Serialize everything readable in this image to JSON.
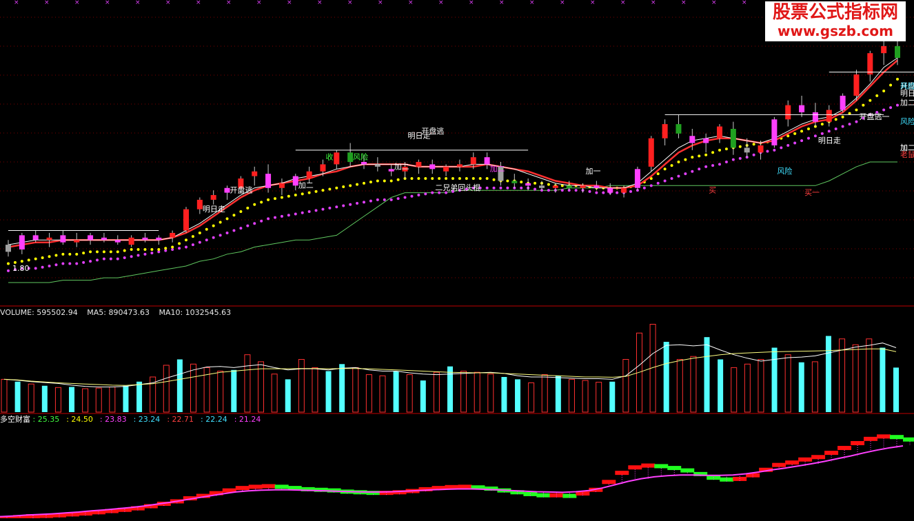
{
  "colors": {
    "up": "#ff2020",
    "down_cyan": "#54ffff",
    "vol_up": "#ff3030",
    "ma_white": "#ffffff",
    "ma_yellow": "#ffff00",
    "dots_yellow": "#ffff00",
    "dots_magenta": "#e040fb",
    "green_line": "#60c860",
    "grid": "#800000",
    "signal_white": "#ffffff",
    "signal_yellow": "#ffff00",
    "signal_cyan": "#40e0ff",
    "signal_green": "#40ff40",
    "signal_magenta": "#ff40ff"
  },
  "watermark": {
    "line1": "股票公式指标网",
    "line2": "www.gszb.com"
  },
  "volume_header": {
    "label": "VOLUME: 595502.94",
    "ma5": "MA5: 890473.63",
    "ma10": "MA10: 1032545.63"
  },
  "indicator_header": {
    "name": "多空财富",
    "values": [
      {
        "text": ": 25.35",
        "color": "#40ff40"
      },
      {
        "text": ": 24.50",
        "color": "#ffff00"
      },
      {
        "text": ": 23.83",
        "color": "#ff40ff"
      },
      {
        "text": ": 23.24",
        "color": "#40e0ff"
      },
      {
        "text": ": 22.71",
        "color": "#ff4040"
      },
      {
        "text": ": 22.24",
        "color": "#40e0ff"
      },
      {
        "text": ": 21.24",
        "color": "#ff40ff"
      }
    ]
  },
  "price_label": "1.80",
  "signals": [
    {
      "text": "明日走",
      "color": "#ffffff"
    },
    {
      "text": "开盘逃",
      "color": "#ffffff"
    },
    {
      "text": "加二",
      "color": "#ffffff"
    },
    {
      "text": "收",
      "color": "#40ff40"
    },
    {
      "text": "风险",
      "color": "#40ff40"
    },
    {
      "text": "明日走",
      "color": "#ffffff"
    },
    {
      "text": "开盘逃",
      "color": "#ffffff"
    },
    {
      "text": "加二",
      "color": "#ffffff"
    },
    {
      "text": "二兄弟回头棍",
      "color": "#ffffff"
    },
    {
      "text": "加一",
      "color": "#ffffff"
    },
    {
      "text": "加二",
      "color": "#ff40ff"
    },
    {
      "text": "风险",
      "color": "#40e0ff"
    },
    {
      "text": "买",
      "color": "#ff4040"
    },
    {
      "text": "买一",
      "color": "#ff4040"
    },
    {
      "text": "明日走",
      "color": "#ffffff"
    },
    {
      "text": "开盘逃一",
      "color": "#ffffff"
    },
    {
      "text": "风险",
      "color": "#40e0ff"
    },
    {
      "text": "加二",
      "color": "#ffffff"
    },
    {
      "text": "老鼠仓",
      "color": "#ff4040"
    },
    {
      "text": "加二",
      "color": "#ffffff"
    },
    {
      "text": "开盘逃",
      "color": "#ffffff"
    },
    {
      "text": "风险",
      "color": "#40e0ff"
    },
    {
      "text": "明日走",
      "color": "#ffffff"
    },
    {
      "text": "加二",
      "color": "#ffffff"
    }
  ],
  "chart_data": [
    {
      "type": "candlestick",
      "name": "price",
      "candles": [
        {
          "o": 1.74,
          "h": 1.76,
          "l": 1.69,
          "c": 1.71
        },
        {
          "o": 1.72,
          "h": 1.79,
          "l": 1.7,
          "c": 1.78
        },
        {
          "o": 1.78,
          "h": 1.8,
          "l": 1.75,
          "c": 1.76
        },
        {
          "o": 1.76,
          "h": 1.79,
          "l": 1.73,
          "c": 1.77
        },
        {
          "o": 1.78,
          "h": 1.8,
          "l": 1.74,
          "c": 1.75
        },
        {
          "o": 1.75,
          "h": 1.79,
          "l": 1.73,
          "c": 1.76
        },
        {
          "o": 1.76,
          "h": 1.79,
          "l": 1.74,
          "c": 1.78
        },
        {
          "o": 1.77,
          "h": 1.79,
          "l": 1.75,
          "c": 1.76
        },
        {
          "o": 1.76,
          "h": 1.78,
          "l": 1.74,
          "c": 1.75
        },
        {
          "o": 1.74,
          "h": 1.78,
          "l": 1.73,
          "c": 1.77
        },
        {
          "o": 1.77,
          "h": 1.79,
          "l": 1.75,
          "c": 1.76
        },
        {
          "o": 1.76,
          "h": 1.78,
          "l": 1.74,
          "c": 1.77
        },
        {
          "o": 1.77,
          "h": 1.8,
          "l": 1.75,
          "c": 1.79
        },
        {
          "o": 1.8,
          "h": 1.9,
          "l": 1.79,
          "c": 1.89
        },
        {
          "o": 1.89,
          "h": 1.94,
          "l": 1.87,
          "c": 1.93
        },
        {
          "o": 1.93,
          "h": 1.97,
          "l": 1.91,
          "c": 1.95
        },
        {
          "o": 1.96,
          "h": 1.99,
          "l": 1.93,
          "c": 1.98
        },
        {
          "o": 1.98,
          "h": 2.03,
          "l": 1.96,
          "c": 2.02
        },
        {
          "o": 2.03,
          "h": 2.07,
          "l": 1.99,
          "c": 2.05
        },
        {
          "o": 2.04,
          "h": 2.08,
          "l": 1.96,
          "c": 1.98
        },
        {
          "o": 1.98,
          "h": 2.02,
          "l": 1.95,
          "c": 2.0
        },
        {
          "o": 1.99,
          "h": 2.04,
          "l": 1.97,
          "c": 2.03
        },
        {
          "o": 2.02,
          "h": 2.07,
          "l": 2.0,
          "c": 2.05
        },
        {
          "o": 2.05,
          "h": 2.1,
          "l": 2.03,
          "c": 2.08
        },
        {
          "o": 2.08,
          "h": 2.14,
          "l": 2.06,
          "c": 2.13
        },
        {
          "o": 2.13,
          "h": 2.17,
          "l": 2.07,
          "c": 2.09
        },
        {
          "o": 2.09,
          "h": 2.12,
          "l": 2.06,
          "c": 2.08
        },
        {
          "o": 2.08,
          "h": 2.11,
          "l": 2.05,
          "c": 2.07
        },
        {
          "o": 2.06,
          "h": 2.08,
          "l": 2.03,
          "c": 2.05
        },
        {
          "o": 2.05,
          "h": 2.09,
          "l": 2.02,
          "c": 2.07
        },
        {
          "o": 2.07,
          "h": 2.1,
          "l": 2.04,
          "c": 2.09
        },
        {
          "o": 2.08,
          "h": 2.1,
          "l": 2.04,
          "c": 2.06
        },
        {
          "o": 2.05,
          "h": 2.08,
          "l": 2.03,
          "c": 2.07
        },
        {
          "o": 2.07,
          "h": 2.1,
          "l": 2.05,
          "c": 2.08
        },
        {
          "o": 2.08,
          "h": 2.13,
          "l": 2.06,
          "c": 2.11
        },
        {
          "o": 2.11,
          "h": 2.13,
          "l": 2.06,
          "c": 2.08
        },
        {
          "o": 2.07,
          "h": 2.09,
          "l": 1.99,
          "c": 2.01
        },
        {
          "o": 2.01,
          "h": 2.04,
          "l": 1.98,
          "c": 2.0
        },
        {
          "o": 2.0,
          "h": 2.02,
          "l": 1.97,
          "c": 1.99
        },
        {
          "o": 1.99,
          "h": 2.01,
          "l": 1.97,
          "c": 1.98
        },
        {
          "o": 1.98,
          "h": 2.0,
          "l": 1.96,
          "c": 1.99
        },
        {
          "o": 1.99,
          "h": 2.01,
          "l": 1.97,
          "c": 1.98
        },
        {
          "o": 1.98,
          "h": 2.0,
          "l": 1.96,
          "c": 1.99
        },
        {
          "o": 1.99,
          "h": 2.01,
          "l": 1.97,
          "c": 1.98
        },
        {
          "o": 1.98,
          "h": 2.0,
          "l": 1.95,
          "c": 1.96
        },
        {
          "o": 1.96,
          "h": 1.99,
          "l": 1.94,
          "c": 1.98
        },
        {
          "o": 1.98,
          "h": 2.07,
          "l": 1.97,
          "c": 2.06
        },
        {
          "o": 2.07,
          "h": 2.2,
          "l": 2.05,
          "c": 2.19
        },
        {
          "o": 2.19,
          "h": 2.27,
          "l": 2.16,
          "c": 2.25
        },
        {
          "o": 2.25,
          "h": 2.29,
          "l": 2.19,
          "c": 2.21
        },
        {
          "o": 2.2,
          "h": 2.23,
          "l": 2.14,
          "c": 2.17
        },
        {
          "o": 2.17,
          "h": 2.21,
          "l": 2.13,
          "c": 2.19
        },
        {
          "o": 2.19,
          "h": 2.25,
          "l": 2.17,
          "c": 2.24
        },
        {
          "o": 2.23,
          "h": 2.26,
          "l": 2.12,
          "c": 2.15
        },
        {
          "o": 2.15,
          "h": 2.19,
          "l": 2.11,
          "c": 2.13
        },
        {
          "o": 2.13,
          "h": 2.18,
          "l": 2.1,
          "c": 2.16
        },
        {
          "o": 2.16,
          "h": 2.28,
          "l": 2.15,
          "c": 2.27
        },
        {
          "o": 2.27,
          "h": 2.35,
          "l": 2.24,
          "c": 2.33
        },
        {
          "o": 2.33,
          "h": 2.37,
          "l": 2.28,
          "c": 2.3
        },
        {
          "o": 2.3,
          "h": 2.34,
          "l": 2.24,
          "c": 2.26
        },
        {
          "o": 2.26,
          "h": 2.33,
          "l": 2.24,
          "c": 2.31
        },
        {
          "o": 2.31,
          "h": 2.38,
          "l": 2.3,
          "c": 2.37
        },
        {
          "o": 2.37,
          "h": 2.48,
          "l": 2.35,
          "c": 2.46
        },
        {
          "o": 2.46,
          "h": 2.56,
          "l": 2.43,
          "c": 2.55
        },
        {
          "o": 2.55,
          "h": 2.61,
          "l": 2.5,
          "c": 2.58
        },
        {
          "o": 2.58,
          "h": 2.6,
          "l": 2.5,
          "c": 2.53
        }
      ],
      "ma_white": [
        1.74,
        1.75,
        1.76,
        1.76,
        1.76,
        1.76,
        1.76,
        1.76,
        1.76,
        1.76,
        1.76,
        1.76,
        1.77,
        1.8,
        1.83,
        1.87,
        1.91,
        1.95,
        1.98,
        1.99,
        2.0,
        2.02,
        2.03,
        2.04,
        2.06,
        2.07,
        2.08,
        2.08,
        2.08,
        2.08,
        2.07,
        2.07,
        2.07,
        2.07,
        2.08,
        2.08,
        2.07,
        2.06,
        2.04,
        2.02,
        2.0,
        1.99,
        1.99,
        1.98,
        1.98,
        1.98,
        2.0,
        2.05,
        2.1,
        2.15,
        2.18,
        2.19,
        2.2,
        2.19,
        2.18,
        2.17,
        2.19,
        2.22,
        2.25,
        2.27,
        2.28,
        2.31,
        2.36,
        2.42,
        2.49,
        2.53
      ],
      "ma_yellow": [
        1.73,
        1.74,
        1.75,
        1.75,
        1.76,
        1.76,
        1.76,
        1.76,
        1.76,
        1.76,
        1.76,
        1.76,
        1.77,
        1.79,
        1.82,
        1.86,
        1.9,
        1.94,
        1.97,
        1.99,
        2.0,
        2.01,
        2.02,
        2.04,
        2.05,
        2.07,
        2.08,
        2.08,
        2.08,
        2.08,
        2.07,
        2.07,
        2.07,
        2.07,
        2.07,
        2.08,
        2.07,
        2.06,
        2.05,
        2.03,
        2.01,
        2.0,
        1.99,
        1.99,
        1.98,
        1.98,
        1.99,
        2.03,
        2.08,
        2.13,
        2.16,
        2.18,
        2.19,
        2.19,
        2.18,
        2.17,
        2.18,
        2.21,
        2.24,
        2.26,
        2.27,
        2.3,
        2.35,
        2.41,
        2.47,
        2.52
      ],
      "dots_yellow": [
        1.66,
        1.67,
        1.68,
        1.69,
        1.7,
        1.7,
        1.71,
        1.71,
        1.71,
        1.72,
        1.72,
        1.72,
        1.73,
        1.76,
        1.79,
        1.82,
        1.85,
        1.88,
        1.91,
        1.93,
        1.94,
        1.95,
        1.96,
        1.97,
        1.98,
        1.99,
        2.0,
        2.01,
        2.01,
        2.02,
        2.02,
        2.02,
        2.02,
        2.02,
        2.02,
        2.02,
        2.01,
        2.01,
        2.0,
        2.0,
        1.99,
        1.99,
        1.99,
        1.98,
        1.98,
        1.98,
        1.99,
        2.02,
        2.06,
        2.09,
        2.11,
        2.12,
        2.14,
        2.15,
        2.16,
        2.17,
        2.18,
        2.2,
        2.22,
        2.24,
        2.26,
        2.28,
        2.31,
        2.35,
        2.39,
        2.44
      ],
      "dots_magenta": [
        1.63,
        1.64,
        1.64,
        1.65,
        1.66,
        1.66,
        1.67,
        1.68,
        1.68,
        1.69,
        1.7,
        1.71,
        1.72,
        1.73,
        1.75,
        1.77,
        1.79,
        1.81,
        1.83,
        1.85,
        1.86,
        1.87,
        1.88,
        1.89,
        1.9,
        1.91,
        1.92,
        1.93,
        1.93,
        1.94,
        1.95,
        1.96,
        1.96,
        1.97,
        1.98,
        1.98,
        1.98,
        1.98,
        1.98,
        1.97,
        1.97,
        1.97,
        1.97,
        1.96,
        1.96,
        1.96,
        1.97,
        1.99,
        2.01,
        2.03,
        2.05,
        2.07,
        2.08,
        2.1,
        2.11,
        2.13,
        2.14,
        2.16,
        2.18,
        2.2,
        2.22,
        2.24,
        2.26,
        2.29,
        2.31,
        2.33
      ],
      "green_line": [
        1.58,
        1.58,
        1.58,
        1.58,
        1.59,
        1.59,
        1.59,
        1.6,
        1.6,
        1.61,
        1.62,
        1.63,
        1.64,
        1.65,
        1.67,
        1.68,
        1.7,
        1.71,
        1.73,
        1.74,
        1.75,
        1.76,
        1.76,
        1.77,
        1.78,
        1.82,
        1.86,
        1.9,
        1.94,
        1.96,
        1.96,
        1.96,
        1.96,
        1.97,
        1.97,
        1.97,
        1.97,
        1.97,
        1.97,
        1.97,
        1.97,
        1.98,
        1.98,
        1.98,
        1.99,
        1.99,
        1.99,
        1.99,
        1.99,
        1.99,
        1.99,
        1.99,
        1.99,
        1.99,
        1.99,
        1.99,
        1.99,
        1.99,
        1.99,
        1.99,
        2.01,
        2.04,
        2.07,
        2.09,
        2.09,
        2.09
      ],
      "ylim": [
        1.58,
        2.6
      ]
    },
    {
      "type": "bar",
      "name": "volume",
      "values": [
        560000,
        520000,
        480000,
        450000,
        420000,
        430000,
        400000,
        410000,
        430000,
        450000,
        520000,
        600000,
        800000,
        900000,
        820000,
        760000,
        700000,
        720000,
        980000,
        860000,
        650000,
        560000,
        900000,
        760000,
        700000,
        820000,
        760000,
        640000,
        620000,
        700000,
        640000,
        540000,
        680000,
        780000,
        700000,
        680000,
        650000,
        600000,
        560000,
        500000,
        640000,
        620000,
        560000,
        540000,
        510000,
        520000,
        900000,
        1350000,
        1500000,
        1200000,
        900000,
        950000,
        1280000,
        900000,
        760000,
        820000,
        900000,
        1100000,
        980000,
        850000,
        860000,
        1300000,
        1250000,
        1150000,
        1250000,
        1100000,
        760000
      ],
      "ma5": [
        560000,
        545000,
        520000,
        505000,
        490000,
        460000,
        440000,
        430000,
        430000,
        440000,
        470000,
        500000,
        580000,
        650000,
        720000,
        770000,
        780000,
        760000,
        790000,
        810000,
        760000,
        720000,
        740000,
        740000,
        720000,
        750000,
        760000,
        720000,
        700000,
        700000,
        670000,
        650000,
        640000,
        650000,
        660000,
        670000,
        680000,
        660000,
        620000,
        600000,
        600000,
        590000,
        580000,
        570000,
        570000,
        560000,
        620000,
        800000,
        1000000,
        1140000,
        1150000,
        1130000,
        1150000,
        1060000,
        980000,
        920000,
        870000,
        900000,
        930000,
        940000,
        960000,
        1010000,
        1060000,
        1110000,
        1140000,
        1180000,
        1100000
      ],
      "ma10": [
        560000,
        550000,
        530000,
        515000,
        500000,
        490000,
        480000,
        470000,
        460000,
        455000,
        470000,
        485000,
        520000,
        560000,
        600000,
        640000,
        680000,
        700000,
        720000,
        740000,
        740000,
        740000,
        745000,
        745000,
        740000,
        745000,
        745000,
        740000,
        730000,
        720000,
        710000,
        700000,
        690000,
        680000,
        675000,
        670000,
        670000,
        660000,
        650000,
        640000,
        630000,
        620000,
        610000,
        600000,
        600000,
        595000,
        610000,
        680000,
        760000,
        830000,
        880000,
        920000,
        950000,
        980000,
        1000000,
        1010000,
        1020000,
        1030000,
        1035000,
        1040000,
        1045000,
        1050000,
        1060000,
        1070000,
        1080000,
        1080000,
        1032545
      ]
    },
    {
      "type": "area",
      "name": "多空财富",
      "fast": [
        0.3,
        0.6,
        0.9,
        1.0,
        1.2,
        1.5,
        1.8,
        2.2,
        2.6,
        3.0,
        3.5,
        4.2,
        5.0,
        5.8,
        6.8,
        7.6,
        8.5,
        9.4,
        10.2,
        10.6,
        10.8,
        10.6,
        10.2,
        9.8,
        9.6,
        9.4,
        9.0,
        8.8,
        8.6,
        8.6,
        8.8,
        9.2,
        9.8,
        10.2,
        10.5,
        10.6,
        10.4,
        10.0,
        9.4,
        8.8,
        8.2,
        7.8,
        7.8,
        7.6,
        8.4,
        9.6,
        12.2,
        15.2,
        17.0,
        17.6,
        17.4,
        16.8,
        16.0,
        14.8,
        13.6,
        13.0,
        13.2,
        14.4,
        16.2,
        17.8,
        18.6,
        19.6,
        20.4,
        21.8,
        23.4,
        25.0,
        26.4,
        27.2,
        27.0,
        26.2
      ],
      "slow": [
        0.1,
        0.3,
        0.6,
        0.8,
        1.0,
        1.3,
        1.6,
        2.0,
        2.3,
        2.7,
        3.1,
        3.6,
        4.2,
        4.8,
        5.5,
        6.2,
        6.9,
        7.6,
        8.2,
        8.6,
        8.8,
        8.9,
        8.9,
        8.8,
        8.7,
        8.6,
        8.4,
        8.3,
        8.2,
        8.2,
        8.3,
        8.5,
        8.7,
        8.9,
        9.1,
        9.2,
        9.2,
        9.1,
        8.9,
        8.7,
        8.5,
        8.3,
        8.2,
        8.1,
        8.3,
        8.7,
        9.5,
        10.6,
        11.7,
        12.6,
        13.2,
        13.6,
        13.8,
        13.8,
        13.7,
        13.7,
        13.8,
        14.2,
        14.8,
        15.5,
        16.1,
        16.8,
        17.5,
        18.3,
        19.2,
        20.1,
        21.1,
        22.0,
        22.8,
        23.4
      ],
      "ylim": [
        0,
        30
      ]
    }
  ]
}
